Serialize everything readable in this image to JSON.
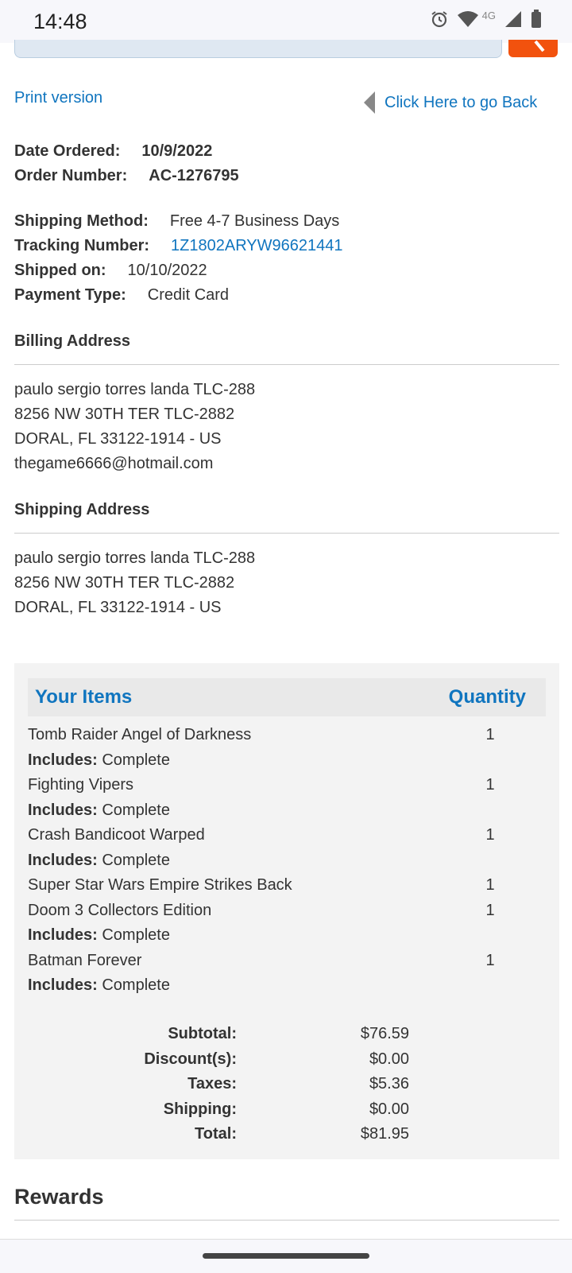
{
  "status": {
    "time": "14:48",
    "network": "4G"
  },
  "nav": {
    "print_label": "Print version",
    "back_label": "Click Here to go Back"
  },
  "order": {
    "date_label": "Date Ordered:",
    "date": "10/9/2022",
    "number_label": "Order Number:",
    "number": "AC-1276795",
    "shipping_method_label": "Shipping Method:",
    "shipping_method": "Free 4-7 Business Days",
    "tracking_label": "Tracking Number:",
    "tracking": "1Z1802ARYW96621441",
    "shipped_label": "Shipped on:",
    "shipped": "10/10/2022",
    "payment_label": "Payment Type:",
    "payment": "Credit Card"
  },
  "billing": {
    "title": "Billing Address",
    "lines": [
      "paulo sergio torres landa TLC-288",
      "8256 NW 30TH TER TLC-2882",
      "DORAL, FL 33122-1914 - US",
      "thegame6666@hotmail.com"
    ]
  },
  "shipping": {
    "title": "Shipping Address",
    "lines": [
      "paulo sergio torres landa TLC-288",
      "8256 NW 30TH TER TLC-2882",
      "DORAL, FL 33122-1914 - US"
    ]
  },
  "items_panel": {
    "header_items": "Your Items",
    "header_qty": "Quantity",
    "includes_label": "Includes:",
    "items": [
      {
        "name": "Tomb Raider Angel of Darkness",
        "qty": "1",
        "includes": "Complete"
      },
      {
        "name": "Fighting Vipers",
        "qty": "1",
        "includes": "Complete"
      },
      {
        "name": "Crash Bandicoot Warped",
        "qty": "1",
        "includes": "Complete"
      },
      {
        "name": "Super Star Wars Empire Strikes Back",
        "qty": "1",
        "includes": ""
      },
      {
        "name": "Doom 3 Collectors Edition",
        "qty": "1",
        "includes": "Complete"
      },
      {
        "name": "Batman Forever",
        "qty": "1",
        "includes": "Complete"
      }
    ]
  },
  "totals": [
    {
      "label": "Subtotal:",
      "value": "$76.59"
    },
    {
      "label": "Discount(s):",
      "value": "$0.00"
    },
    {
      "label": "Taxes:",
      "value": "$5.36"
    },
    {
      "label": "Shipping:",
      "value": "$0.00"
    },
    {
      "label": "Total:",
      "value": "$81.95"
    }
  ],
  "rewards_title": "Rewards",
  "colors": {
    "link": "#1075bf",
    "search_button": "#f2520e"
  },
  "icons": [
    "alarm-icon",
    "wifi-icon",
    "signal-icon",
    "battery-icon",
    "search-icon",
    "back-arrow-icon"
  ]
}
